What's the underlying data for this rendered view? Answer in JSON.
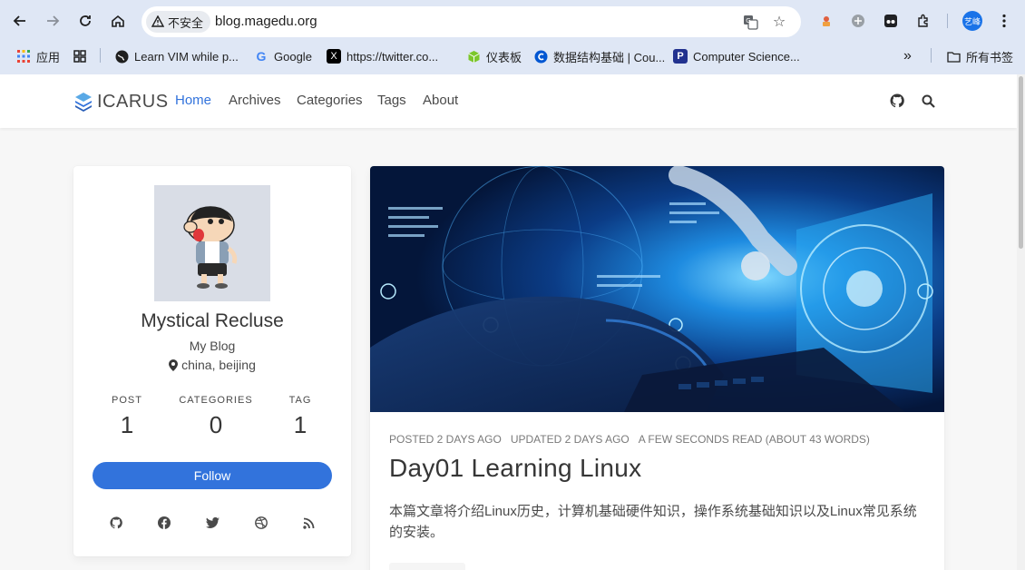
{
  "browser": {
    "security_label": "不安全",
    "url": "blog.magedu.org",
    "profile_initials": "艺峰"
  },
  "bookmarks": {
    "items": [
      {
        "label": "应用",
        "icon": "apps-grid-icon"
      },
      {
        "label": "",
        "icon": "grid-icon"
      },
      {
        "label": "Learn VIM while p...",
        "icon": "globe-icon"
      },
      {
        "label": "Google",
        "icon": "google-icon"
      },
      {
        "label": "https://twitter.co...",
        "icon": "x-logo-icon"
      },
      {
        "label": "仪表板",
        "icon": "cube-icon"
      },
      {
        "label": "数据结构基础 | Cou...",
        "icon": "coursera-icon"
      },
      {
        "label": "Computer Science...",
        "icon": "p-logo-icon"
      }
    ],
    "all_bookmarks": "所有书签"
  },
  "site": {
    "logo_text": "ICARUS",
    "nav": [
      "Home",
      "Archives",
      "Categories",
      "Tags",
      "About"
    ],
    "active_nav": "Home"
  },
  "profile": {
    "name": "Mystical Recluse",
    "title": "My Blog",
    "location": "china, beijing",
    "stats": [
      {
        "label": "POST",
        "value": "1"
      },
      {
        "label": "CATEGORIES",
        "value": "0"
      },
      {
        "label": "TAG",
        "value": "1"
      }
    ],
    "follow_label": "Follow",
    "social": [
      "github-icon",
      "facebook-icon",
      "twitter-icon",
      "dribbble-icon",
      "rss-icon"
    ]
  },
  "post": {
    "posted": "Posted 2 days ago",
    "updated": "Updated 2 days ago",
    "reading": "a few seconds read (About 43 words)",
    "title": "Day01 Learning Linux",
    "excerpt": "本篇文章将介绍Linux历史，计算机基础硬件知识，操作系统基础知识以及Linux常见系统的安装。"
  },
  "colors": {
    "accent": "#3273dc",
    "chrome": "#dfe7f5"
  }
}
